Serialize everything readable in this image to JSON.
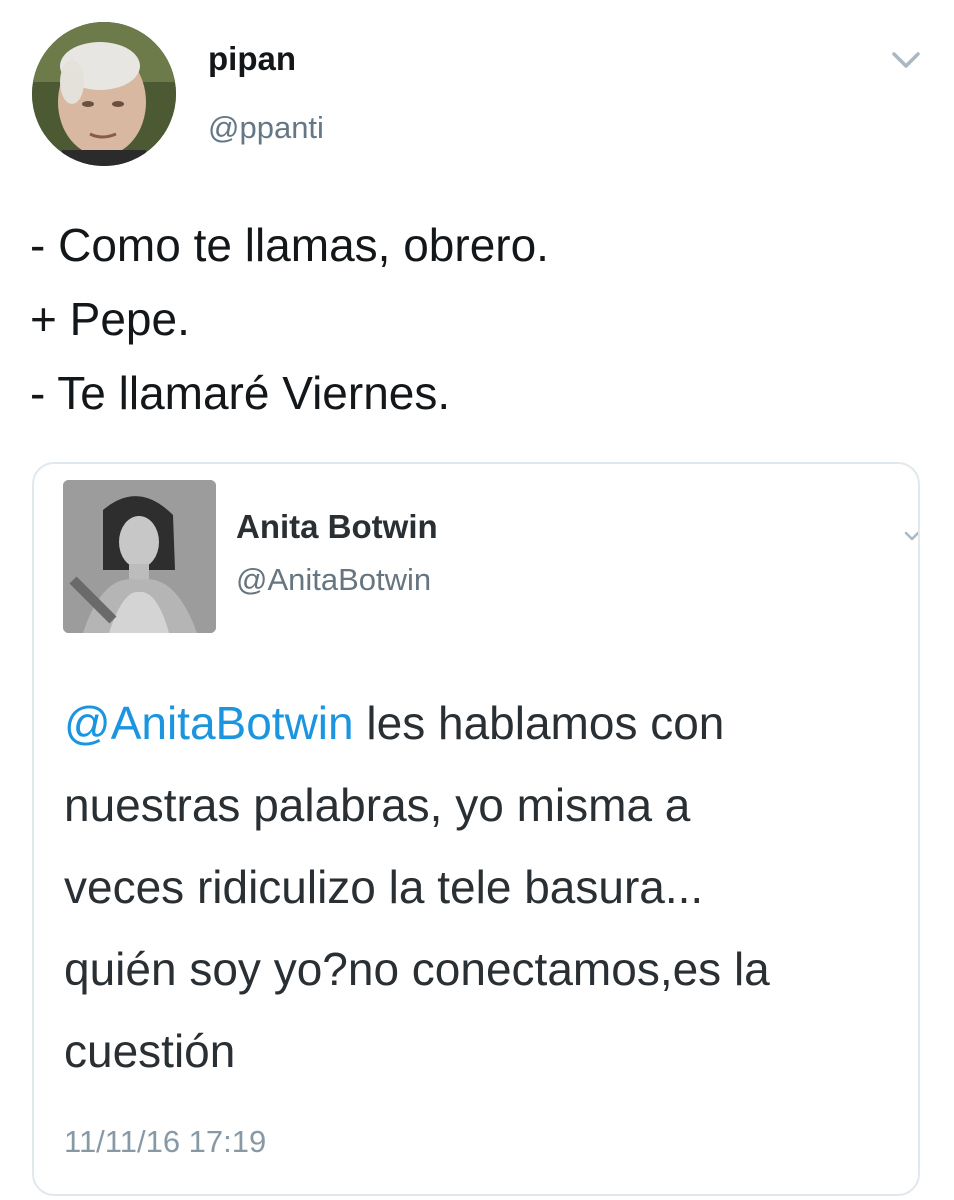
{
  "tweet": {
    "display_name": "pipan",
    "handle": "@ppanti",
    "avatar_icon": "user-avatar-photo",
    "menu_icon": "chevron-down-icon",
    "text_lines": [
      "- Como te llamas, obrero.",
      "+ Pepe.",
      "- Te llamaré Viernes."
    ]
  },
  "quoted": {
    "display_name": "Anita Botwin",
    "handle": "@AnitaBotwin",
    "avatar_icon": "user-avatar-photo",
    "menu_icon": "chevron-down-icon",
    "mention": "@AnitaBotwin",
    "text_lines": [
      " les hablamos con",
      "nuestras palabras, yo misma a",
      "veces ridiculizo la tele basura...",
      "quién soy yo?no conectamos,es la",
      "cuestión"
    ],
    "timestamp": "11/11/16 17:19"
  },
  "colors": {
    "mention": "#1b95e0",
    "handle": "#657786",
    "card_border": "#e1e8ed"
  }
}
